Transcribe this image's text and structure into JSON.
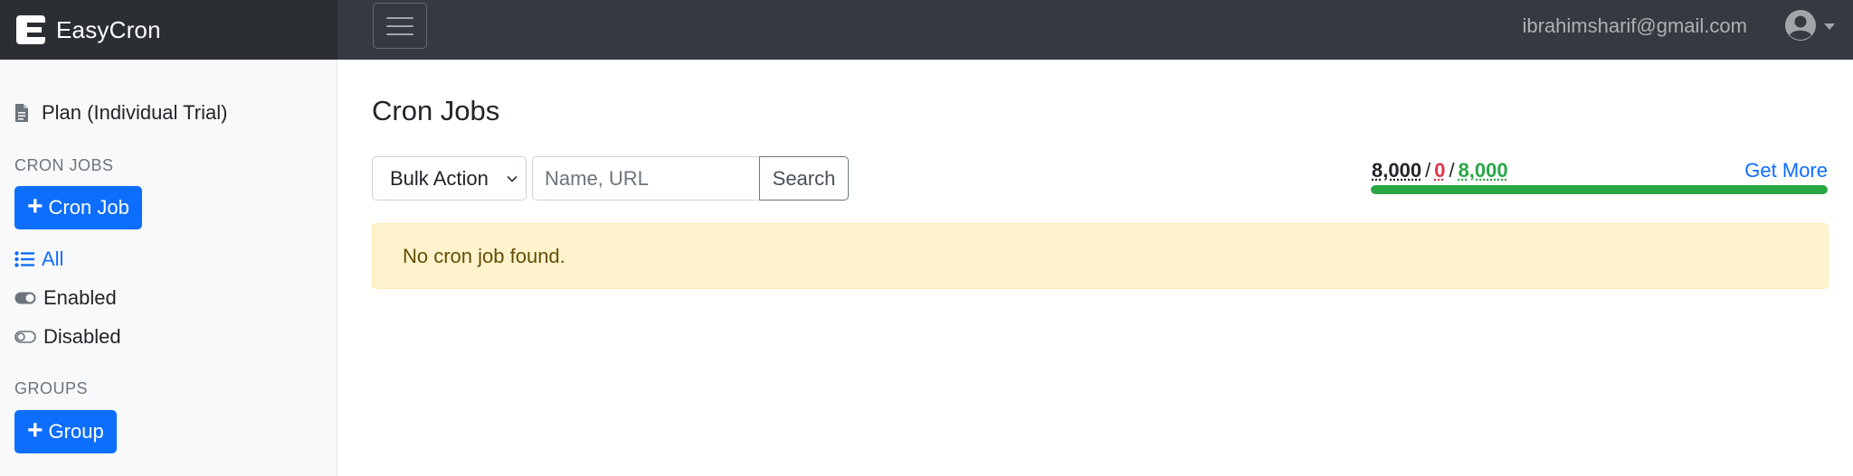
{
  "brand": {
    "name": "EasyCron"
  },
  "topnav": {
    "user_email": "ibrahimsharif@gmail.com"
  },
  "sidebar": {
    "plan_label": "Plan (Individual Trial)",
    "cron_section_title": "CRON JOBS",
    "add_cron_label": "Cron Job",
    "nav_items": [
      {
        "label": "All",
        "icon": "list-icon",
        "active": true
      },
      {
        "label": "Enabled",
        "icon": "toggle-on-icon",
        "active": false
      },
      {
        "label": "Disabled",
        "icon": "toggle-off-icon",
        "active": false
      }
    ],
    "groups_section_title": "GROUPS",
    "add_group_label": "Group"
  },
  "main": {
    "title": "Cron Jobs",
    "bulk_action": {
      "selected": "Bulk Action"
    },
    "search": {
      "placeholder": "Name, URL",
      "value": "",
      "button_label": "Search"
    },
    "quota": {
      "total": "8,000",
      "used": "0",
      "remaining": "8,000",
      "separator": "/",
      "get_more_label": "Get More",
      "fill_fraction": 1.0
    },
    "alert_text": "No cron job found."
  },
  "colors": {
    "primary": "#0d6efd",
    "success": "#28a745",
    "danger": "#dc3545",
    "warning_bg": "#fff3cd",
    "navbar": "#343a40"
  }
}
